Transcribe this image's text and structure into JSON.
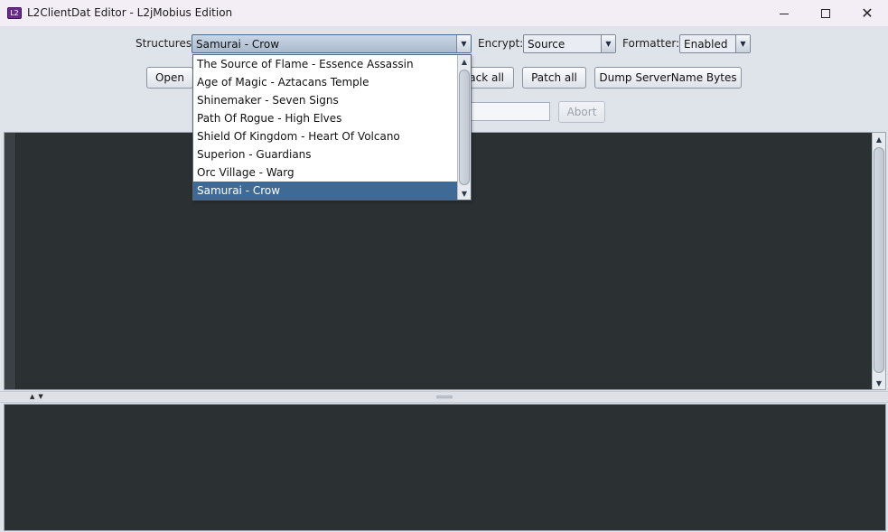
{
  "window": {
    "title": "L2ClientDat Editor - L2jMobius Edition",
    "icon_text": "L2",
    "minimize_icon": "minimize-icon",
    "maximize_icon": "maximize-icon",
    "close_icon": "close-icon"
  },
  "toolbar": {
    "structures_label": "Structures",
    "structures_value": "Samurai - Crow",
    "encrypt_label": "Encrypt:",
    "encrypt_value": "Source",
    "formatter_label": "Formatter:",
    "formatter_value": "Enabled",
    "open_label": "Open",
    "unpack_all_partial": "ack all",
    "patch_all_label": "Patch all",
    "dump_label": "Dump ServerName Bytes",
    "abort_label": "Abort"
  },
  "structures_dropdown": {
    "options": [
      "The Source of Flame - Essence Assassin",
      "Age of Magic - Aztacans Temple",
      "Shinemaker - Seven Signs",
      "Path Of Rogue - High Elves",
      "Shield Of Kingdom - Heart Of Volcano",
      "Superion - Guardians",
      "Orc Village - Warg",
      "Samurai - Crow"
    ],
    "selected_index": 7
  },
  "colors": {
    "editor_bg": "#2b3133",
    "selection": "#3e6a95",
    "titlebar": "#f3eef5"
  }
}
